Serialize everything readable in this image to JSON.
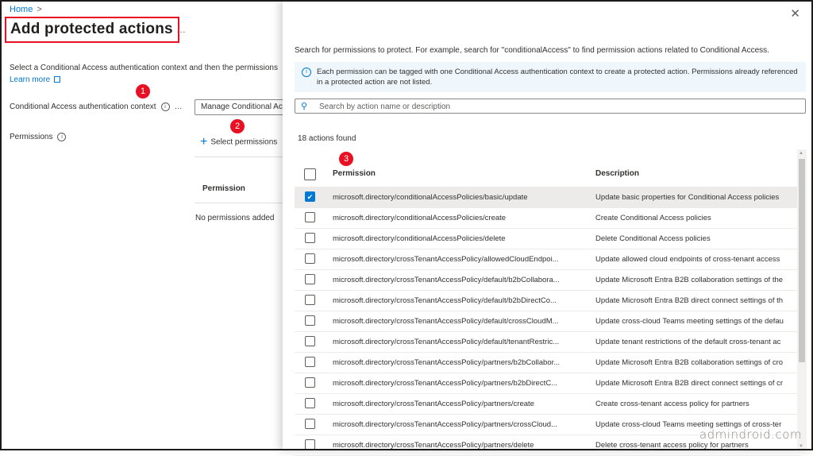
{
  "breadcrumb": {
    "home": "Home",
    "sep": ">"
  },
  "page": {
    "title": "Add protected actions",
    "more": "…",
    "intro": "Select a Conditional Access authentication context and then the permissions",
    "learn_more": "Learn more"
  },
  "form": {
    "context_label": "Conditional Access authentication context",
    "context_more": "…",
    "context_value": "Manage Conditional Access",
    "permissions_label": "Permissions",
    "select_permissions": "Select permissions",
    "table_header": "Permission",
    "empty_text": "No permissions added"
  },
  "badges": [
    "1",
    "2",
    "3"
  ],
  "panel": {
    "description": "Search for permissions to protect. For example, search for \"conditionalAccess\" to find permission actions related to Conditional Access.",
    "info": "Each permission can be tagged with one Conditional Access authentication context to create a protected action. Permissions already referenced in a protected action are not listed.",
    "search_placeholder": "Search by action name or description",
    "count": "18 actions found",
    "columns": {
      "permission": "Permission",
      "description": "Description"
    },
    "rows": [
      {
        "permission": "microsoft.directory/conditionalAccessPolicies/basic/update",
        "description": "Update basic properties for Conditional Access policies",
        "checked": true
      },
      {
        "permission": "microsoft.directory/conditionalAccessPolicies/create",
        "description": "Create Conditional Access policies",
        "checked": false
      },
      {
        "permission": "microsoft.directory/conditionalAccessPolicies/delete",
        "description": "Delete Conditional Access policies",
        "checked": false
      },
      {
        "permission": "microsoft.directory/crossTenantAccessPolicy/allowedCloudEndpoi...",
        "description": "Update allowed cloud endpoints of cross-tenant access",
        "checked": false
      },
      {
        "permission": "microsoft.directory/crossTenantAccessPolicy/default/b2bCollabora...",
        "description": "Update Microsoft Entra B2B collaboration settings of the",
        "checked": false
      },
      {
        "permission": "microsoft.directory/crossTenantAccessPolicy/default/b2bDirectCo...",
        "description": "Update Microsoft Entra B2B direct connect settings of th",
        "checked": false
      },
      {
        "permission": "microsoft.directory/crossTenantAccessPolicy/default/crossCloudM...",
        "description": "Update cross-cloud Teams meeting settings of the defau",
        "checked": false
      },
      {
        "permission": "microsoft.directory/crossTenantAccessPolicy/default/tenantRestric...",
        "description": "Update tenant restrictions of the default cross-tenant ac",
        "checked": false
      },
      {
        "permission": "microsoft.directory/crossTenantAccessPolicy/partners/b2bCollabor...",
        "description": "Update Microsoft Entra B2B collaboration settings of cro",
        "checked": false
      },
      {
        "permission": "microsoft.directory/crossTenantAccessPolicy/partners/b2bDirectC...",
        "description": "Update Microsoft Entra B2B direct connect settings of cr",
        "checked": false
      },
      {
        "permission": "microsoft.directory/crossTenantAccessPolicy/partners/create",
        "description": "Create cross-tenant access policy for partners",
        "checked": false
      },
      {
        "permission": "microsoft.directory/crossTenantAccessPolicy/partners/crossCloud...",
        "description": "Update cross-cloud Teams meeting settings of cross-ter",
        "checked": false
      },
      {
        "permission": "microsoft.directory/crossTenantAccessPolicy/partners/delete",
        "description": "Delete cross-tenant access policy for partners",
        "checked": false
      }
    ]
  },
  "watermark": "admindroid.com",
  "colors": {
    "accent": "#0078d4",
    "badge": "#e81123",
    "highlight_border": "#e81123"
  }
}
